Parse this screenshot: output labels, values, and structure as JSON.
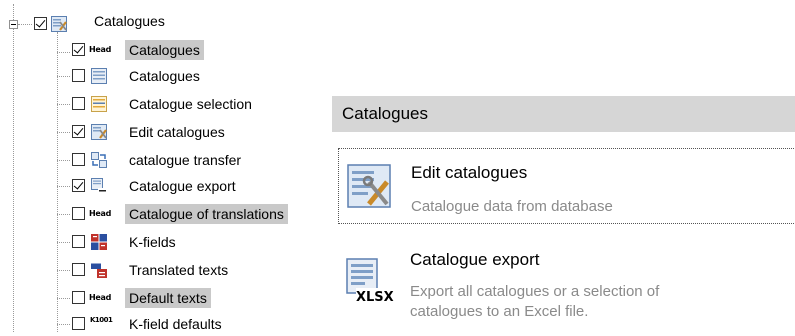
{
  "tree": {
    "root": {
      "label": "Catalogues",
      "checked": true,
      "icon": "edit-catalogues-icon"
    },
    "items": [
      {
        "label": "Catalogues",
        "checked": true,
        "icon": "head-icon",
        "selected": true
      },
      {
        "label": "Catalogues",
        "checked": false,
        "icon": "catalogue-icon",
        "selected": false
      },
      {
        "label": "Catalogue selection",
        "checked": false,
        "icon": "catalogue-selection-icon",
        "selected": false
      },
      {
        "label": "Edit catalogues",
        "checked": true,
        "icon": "edit-catalogues-icon",
        "selected": false
      },
      {
        "label": "catalogue transfer",
        "checked": false,
        "icon": "transfer-icon",
        "selected": false
      },
      {
        "label": "Catalogue export",
        "checked": true,
        "icon": "xlsx-export-icon",
        "selected": false
      },
      {
        "label": "Catalogue of translations",
        "checked": false,
        "icon": "head-icon",
        "selected": true
      },
      {
        "label": "K-fields",
        "checked": false,
        "icon": "kfields-icon",
        "selected": false
      },
      {
        "label": "Translated texts",
        "checked": false,
        "icon": "translated-texts-icon",
        "selected": false
      },
      {
        "label": "Default texts",
        "checked": false,
        "icon": "head-icon",
        "selected": true
      },
      {
        "label": "K-field defaults",
        "checked": false,
        "icon": "kfield-defaults-icon",
        "selected": false
      }
    ],
    "head_icon_text": "Head",
    "kfield_defaults_icon_text": "K1001"
  },
  "panel": {
    "title": "Catalogues",
    "tiles": [
      {
        "title": "Edit catalogues",
        "description": "Catalogue data from database",
        "icon": "edit-catalogues-icon",
        "focused": true
      },
      {
        "title": "Catalogue export",
        "description_lines": [
          "Export all catalogues or a selection of",
          "catalogues to an Excel file."
        ],
        "icon": "xlsx-export-icon",
        "icon_text": "XLSX",
        "focused": false
      }
    ]
  }
}
